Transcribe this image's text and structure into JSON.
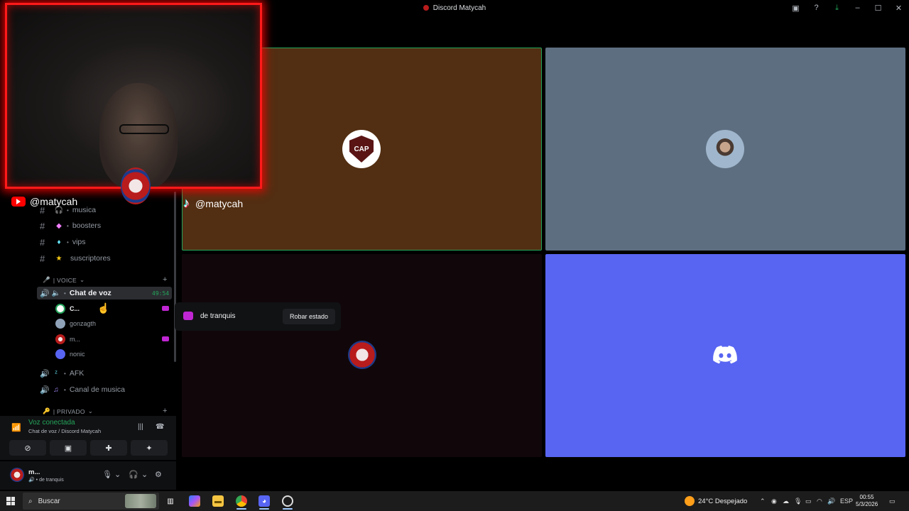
{
  "window": {
    "title": "Discord Matycah",
    "controls": [
      "screen-icon",
      "help-icon",
      "download-icon",
      "minimize-icon",
      "maximize-icon",
      "close-icon"
    ]
  },
  "sidebar": {
    "text_channels": [
      {
        "name": "musica",
        "icon": "headphones-icon"
      },
      {
        "name": "boosters",
        "icon": "boost-icon"
      },
      {
        "name": "vips",
        "icon": "diamond-icon"
      },
      {
        "name": "suscriptores",
        "icon": "star-icon"
      }
    ],
    "voice_category": "| VOICE",
    "voice_channels": [
      {
        "name": "Chat de voz",
        "timer": "49:54"
      },
      {
        "name": "AFK"
      },
      {
        "name": "Canal de musica"
      }
    ],
    "members": [
      {
        "name": "C...",
        "color": "#f2f3f5"
      },
      {
        "name": "gonzagth",
        "color": "#949ba4"
      },
      {
        "name": "m...",
        "color": "#949ba4"
      },
      {
        "name": "nonic",
        "color": "#949ba4"
      }
    ],
    "private_category": "| PRIVADO"
  },
  "tooltip": {
    "label": "de tranquis",
    "button": "Robar estado"
  },
  "connection": {
    "title": "Voz conectada",
    "subtitle": "Chat de voz / Discord Matycah"
  },
  "user": {
    "name": "m...",
    "status": "de tranquis"
  },
  "overlay": {
    "youtube_handle": "@matycah",
    "tiktok_handle": "@matycah"
  },
  "tiles": {
    "cap_text": "CAP"
  },
  "taskbar": {
    "search_placeholder": "Buscar",
    "weather": "24°C  Despejado",
    "language": "ESP",
    "time": "00:55",
    "date": "5/3/2026"
  },
  "colors": {
    "accent_green": "#23a55a",
    "blurple": "#5865f2",
    "brown_tile": "#522e12",
    "gray_tile": "#5d6e80",
    "cam_border": "#ff1a1a"
  }
}
